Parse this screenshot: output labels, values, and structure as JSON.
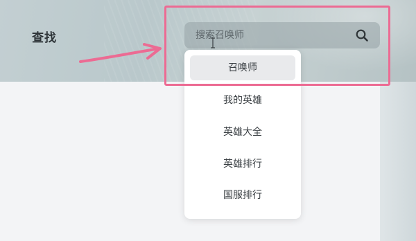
{
  "header": {
    "title": "查找"
  },
  "search": {
    "placeholder": "搜索召唤师"
  },
  "dropdown": {
    "items": [
      {
        "label": "召唤师",
        "active": true
      },
      {
        "label": "我的英雄",
        "active": false
      },
      {
        "label": "英雄大全",
        "active": false
      },
      {
        "label": "英雄排行",
        "active": false
      },
      {
        "label": "国服排行",
        "active": false
      }
    ]
  },
  "icons": {
    "search": "search-icon",
    "cursor": "text-cursor-icon"
  },
  "annotation": {
    "highlight_color": "#ec6b93",
    "arrow_color": "#ec6b93"
  },
  "colors": {
    "header_bg": "#bfcbce",
    "panel_bg": "#f3f4f6",
    "dropdown_bg": "#ffffff",
    "active_item_bg": "#e9eaec",
    "title_text": "#2e3438"
  }
}
